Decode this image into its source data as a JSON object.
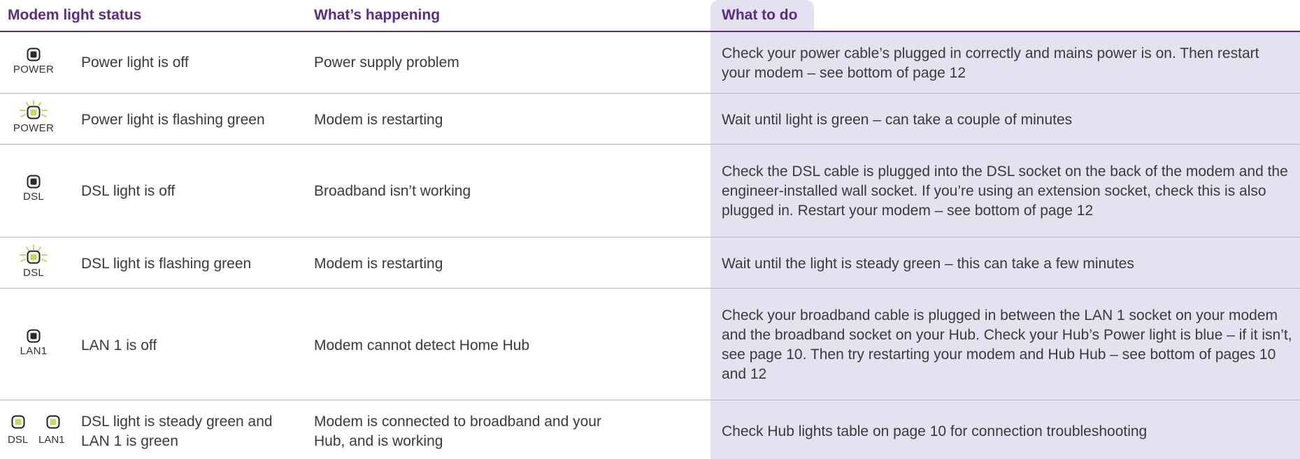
{
  "headers": {
    "status": "Modem light status",
    "happening": "What’s happening",
    "todo": "What to do"
  },
  "colors": {
    "heading": "#5b2a8e",
    "todo_background": "#e4e1f0",
    "led_green": "#c8d85a",
    "led_off": "#2b2b2b"
  },
  "rows": [
    {
      "icon": "led-off-icon",
      "icon_label": "POWER",
      "status": "Power light is off",
      "happening": "Power supply problem",
      "todo": "Check your power cable’s plugged in correctly and mains power is on. Then restart your modem – see bottom of page 12"
    },
    {
      "icon": "led-flashing-green-icon",
      "icon_label": "POWER",
      "status": "Power light is flashing green",
      "happening": "Modem is restarting",
      "todo": "Wait until light is green – can take a couple of minutes"
    },
    {
      "icon": "led-off-icon",
      "icon_label": "DSL",
      "status": "DSL light is off",
      "happening": "Broadband isn’t working",
      "todo": "Check the DSL cable is plugged into the DSL socket on the back of the modem and the engineer-installed wall socket. If you’re using an extension socket, check this is also plugged in. Restart your modem – see bottom of page 12"
    },
    {
      "icon": "led-flashing-green-icon",
      "icon_label": "DSL",
      "status": "DSL light is flashing green",
      "happening": "Modem is restarting",
      "todo": "Wait until the light is steady green – this can take a few minutes"
    },
    {
      "icon": "led-off-icon",
      "icon_label": "LAN1",
      "status": "LAN 1 is off",
      "happening": "Modem cannot detect Home Hub",
      "todo": "Check your broadband cable is plugged in between the LAN 1 socket on your modem and the broadband socket on your Hub. Check your Hub’s Power light is blue – if it isn’t, see page 10. Then try restarting your modem and Hub Hub – see bottom of pages 10 and 12"
    },
    {
      "icon": "led-steady-green-icon",
      "icon_label": "DSL",
      "icon_label_2": "LAN1",
      "status": "DSL light is steady green and LAN 1 is green",
      "happening": "Modem is connected to broadband and your Hub, and is working",
      "todo": "Check Hub lights table on page 10 for connection troubleshooting"
    }
  ]
}
